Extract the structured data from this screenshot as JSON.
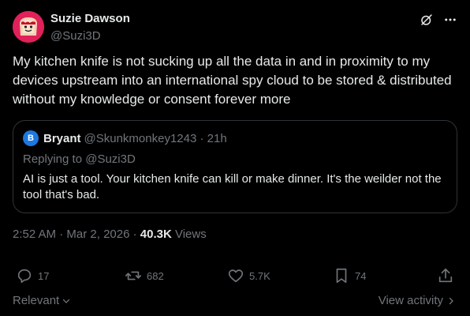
{
  "author": {
    "display_name": "Suzie Dawson",
    "handle": "@Suzi3D"
  },
  "tweet": {
    "text": "My kitchen knife is not sucking up all the data in and in proximity to my devices upstream into an international spy cloud to be stored & distributed without my knowledge or consent forever more"
  },
  "quote": {
    "avatar_letter": "B",
    "name": "Bryant",
    "handle_time": "@Skunkmonkey1243 · 21h",
    "replying": "Replying to @Suzi3D",
    "text": "AI is just a tool. Your kitchen knife can kill or make dinner. It's the weilder not the tool that's bad."
  },
  "meta": {
    "time": "2:52 AM",
    "date": "Mar 2, 2026",
    "views_count": "40.3K",
    "views_label": "Views"
  },
  "actions": {
    "replies": "17",
    "reposts": "682",
    "likes": "5.7K",
    "bookmarks": "74"
  },
  "footer": {
    "relevant": "Relevant",
    "view_activity": "View activity"
  },
  "colors": {
    "background": "#000000",
    "text": "#e7e9ea",
    "muted": "#71767b",
    "border": "#2f3336",
    "avatar": "#e0215a",
    "quote_avatar": "#1d77e0"
  },
  "icons": [
    "grok-icon",
    "more-icon",
    "reply-icon",
    "repost-icon",
    "like-icon",
    "bookmark-icon",
    "share-icon",
    "chevron-down-icon",
    "chevron-right-icon"
  ]
}
